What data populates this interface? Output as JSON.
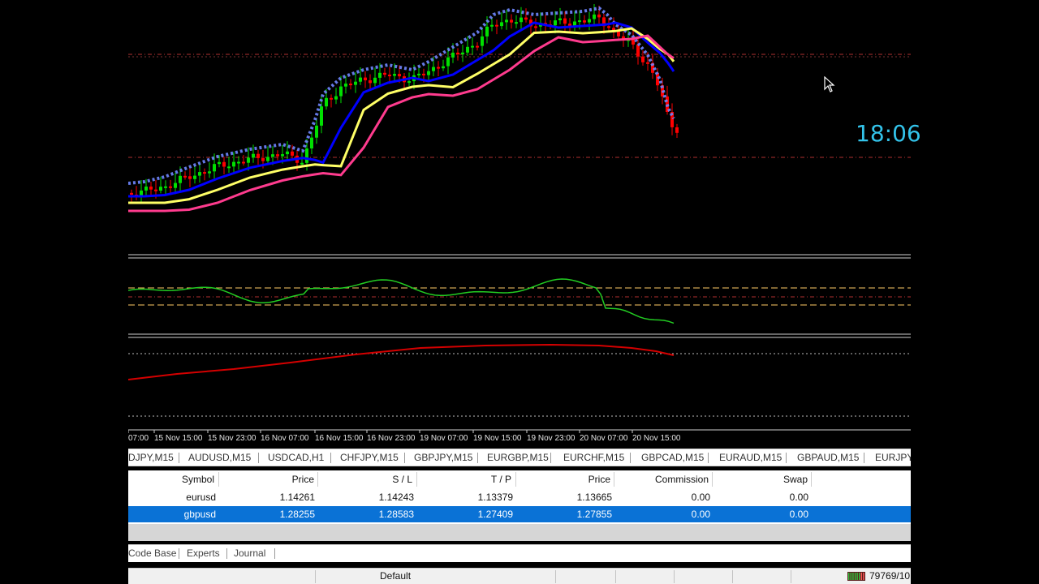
{
  "chart": {
    "clock": "18:06",
    "time_labels": [
      "07:00",
      "15 Nov 15:00",
      "15 Nov 23:00",
      "16 Nov 07:00",
      "16 Nov 15:00",
      "16 Nov 23:00",
      "19 Nov 07:00",
      "19 Nov 15:00",
      "19 Nov 23:00",
      "20 Nov 07:00",
      "20 Nov 15:00"
    ],
    "colors": {
      "background": "#000000",
      "bull_candle": "#00e000",
      "bear_candle": "#ff0000",
      "ma_blue": "#0000ff",
      "ma_yellow": "#ffff66",
      "ma_pink": "#ff3b8e",
      "envelope_blue": "#6f86ff",
      "oscillator": "#22cc22",
      "oscillator_levels": "#ffcc66",
      "lower_indicator": "#d40000",
      "level_line": "#b03030"
    }
  },
  "symbol_tabs": [
    "DJPY,M15",
    "AUDUSD,M15",
    "USDCAD,H1",
    "CHFJPY,M15",
    "GBPJPY,M15",
    "EURGBP,M15",
    "EURCHF,M15",
    "GBPCAD,M15",
    "EURAUD,M15",
    "GBPAUD,M15",
    "EURJPY,"
  ],
  "orders": {
    "headers": {
      "symbol": "Symbol",
      "price": "Price",
      "sl": "S / L",
      "tp": "T / P",
      "price2": "Price",
      "commission": "Commission",
      "swap": "Swap"
    },
    "rows": [
      {
        "symbol": "eurusd",
        "price": "1.14261",
        "sl": "1.14243",
        "tp": "1.13379",
        "price2": "1.13665",
        "commission": "0.00",
        "swap": "0.00",
        "selected": false
      },
      {
        "symbol": "gbpusd",
        "price": "1.28255",
        "sl": "1.28583",
        "tp": "1.27409",
        "price2": "1.27855",
        "commission": "0.00",
        "swap": "0.00",
        "selected": true
      }
    ]
  },
  "bottom_tabs": [
    "Code Base",
    "Experts",
    "Journal"
  ],
  "status": {
    "profile": "Default",
    "traffic": "79769/10"
  }
}
